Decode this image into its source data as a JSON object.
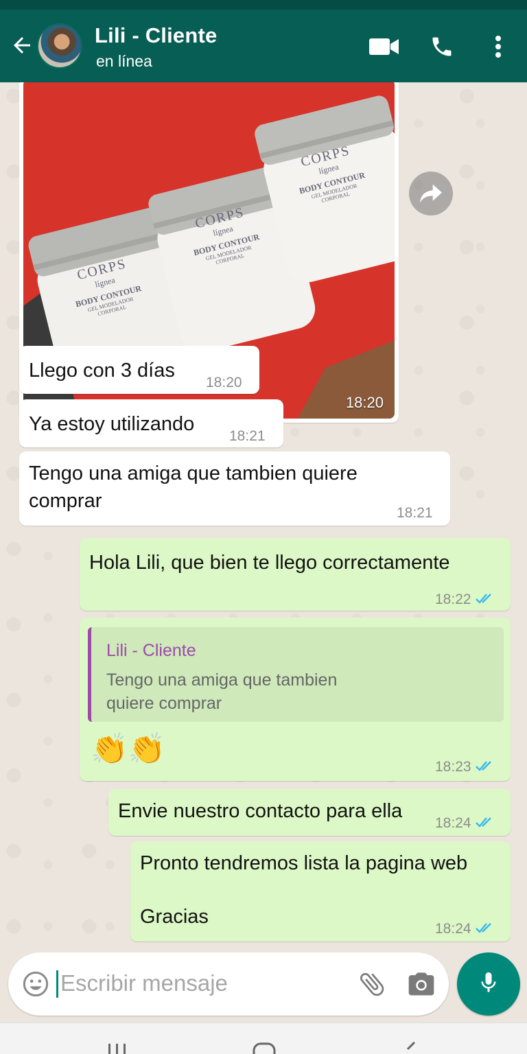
{
  "header": {
    "contact_name": "Lili - Cliente",
    "contact_status": "en línea",
    "bg_color": "#075e54"
  },
  "image_message": {
    "time": "18:20",
    "products": [
      {
        "brand": "CORPS",
        "sub": "lígnea",
        "name": "BODY CONTOUR",
        "desc": "GEL MODELADOR CORPORAL"
      },
      {
        "brand": "CORPS",
        "sub": "lígnea",
        "name": "BODY CONTOUR",
        "desc": "GEL MODELADOR CORPORAL"
      },
      {
        "brand": "CORPS",
        "sub": "lígnea",
        "name": "BODY CONTOUR",
        "desc": "GEL MODELADOR CORPORAL"
      }
    ]
  },
  "messages": [
    {
      "dir": "in",
      "text": "Llego con 3 días",
      "time": "18:20"
    },
    {
      "dir": "in",
      "text": "Ya estoy utilizando",
      "time": "18:21"
    },
    {
      "dir": "in",
      "text_line1": "Tengo una amiga que tambien quiere",
      "text_line2": "comprar",
      "time": "18:21"
    },
    {
      "dir": "out",
      "text": "Hola Lili, que bien te llego correctamente",
      "time": "18:22"
    },
    {
      "dir": "out",
      "quote_name": "Lili - Cliente",
      "quote_line1": "Tengo una amiga que tambien",
      "quote_line2": "quiere comprar",
      "emoji": "👏👏",
      "time": "18:23"
    },
    {
      "dir": "out",
      "text": "Envie nuestro contacto para ella",
      "time": "18:24"
    },
    {
      "dir": "out",
      "text_line1": "Pronto tendremos lista la pagina web",
      "text_line2": "Gracias",
      "time": "18:24"
    }
  ],
  "input": {
    "placeholder": "Escribir mensaje"
  },
  "colors": {
    "outgoing": "#dcf8c6",
    "incoming": "#ffffff",
    "read_ticks": "#34b7f1",
    "mic_button": "#00897b"
  },
  "icons": [
    "back-arrow-icon",
    "video-call-icon",
    "phone-icon",
    "more-icon",
    "forward-icon",
    "emoji-icon",
    "attach-icon",
    "camera-icon",
    "mic-icon",
    "read-ticks-icon"
  ]
}
